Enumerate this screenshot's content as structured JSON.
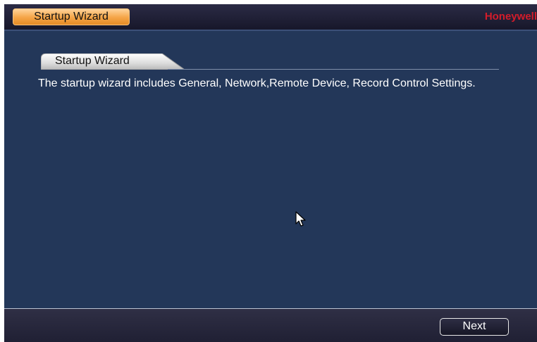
{
  "titlebar": {
    "button_label": "Startup Wizard",
    "brand": "Honeywell",
    "brand_color": "#d41c2a"
  },
  "section": {
    "tab_label": "Startup Wizard",
    "description": "The startup wizard includes General, Network,Remote Device, Record Control Settings."
  },
  "footer": {
    "next_label": "Next"
  },
  "colors": {
    "background": "#233759",
    "accent": "#f5a446"
  },
  "icons": {
    "pointer": "mouse-pointer-icon"
  }
}
